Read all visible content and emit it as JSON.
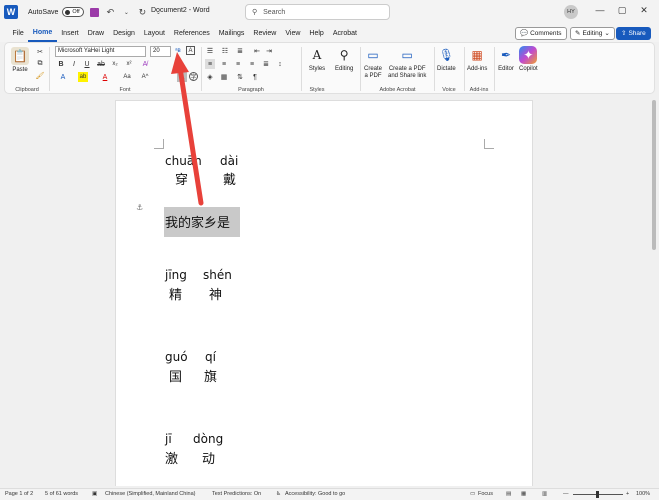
{
  "titlebar": {
    "autosave_label": "AutoSave",
    "autosave_state": "Off",
    "doc_title": "Document2 - Word",
    "search_placeholder": "Search",
    "avatar_initials": "HY"
  },
  "menu": [
    "File",
    "Home",
    "Insert",
    "Draw",
    "Design",
    "Layout",
    "References",
    "Mailings",
    "Review",
    "View",
    "Help",
    "Acrobat"
  ],
  "menu_active": "Home",
  "actions": {
    "comments": "Comments",
    "editing": "Editing",
    "share": "Share"
  },
  "ribbon": {
    "paste": "Paste",
    "font_name": "Microsoft YaHei Light",
    "font_size": "20",
    "styles": "Styles",
    "editing": "Editing",
    "create_pdf": "Create\na PDF",
    "create_pdf_share": "Create a PDF\nand Share link",
    "dictate": "Dictate",
    "addins": "Add-ins",
    "editor": "Editor",
    "copilot": "Copilot",
    "groups": {
      "clipboard": "Clipboard",
      "font": "Font",
      "paragraph": "Paragraph",
      "styles": "Styles",
      "adobe": "Adobe Acrobat",
      "voice": "Voice",
      "addins": "Add-ins"
    }
  },
  "document": {
    "word1": {
      "py1": "chuān",
      "py2": "dài",
      "hz1": "穿",
      "hz2": "戴"
    },
    "selected_text": "我的家乡是",
    "word2": {
      "py1": "jīng",
      "py2": "shén",
      "hz1": "精",
      "hz2": "神"
    },
    "word3": {
      "py1": "guó",
      "py2": "qí",
      "hz1": "国",
      "hz2": "旗"
    },
    "word4": {
      "py1": "jī",
      "py2": "dòng",
      "hz1": "激",
      "hz2": "动"
    }
  },
  "status": {
    "page": "Page 1 of 2",
    "words": "5 of 61 words",
    "language": "Chinese (Simplified, Mainland China)",
    "predictions": "Text Predictions: On",
    "accessibility": "Accessibility: Good to go",
    "focus": "Focus",
    "zoom": "100%"
  },
  "colors": {
    "accent": "#185abd",
    "arrow": "#e8413a"
  }
}
